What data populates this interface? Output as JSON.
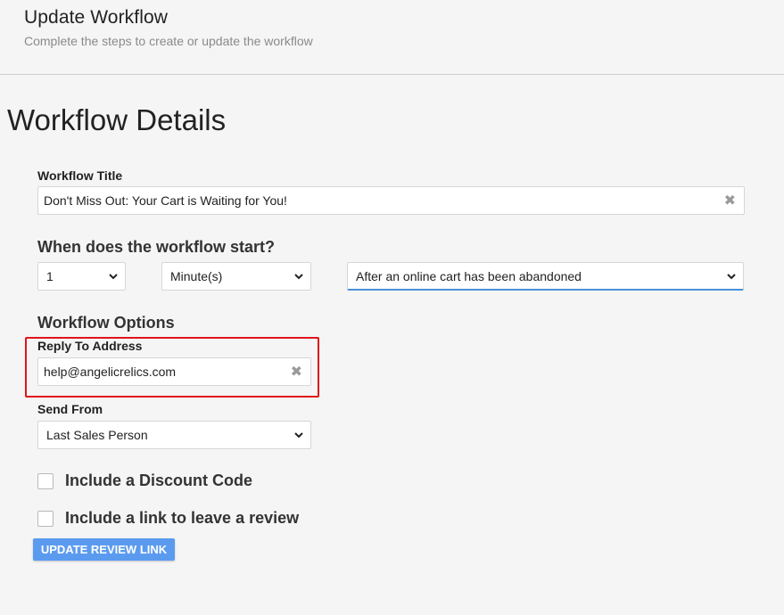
{
  "header": {
    "title": "Update Workflow",
    "subtitle": "Complete the steps to create or update the workflow"
  },
  "section": {
    "title": "Workflow Details"
  },
  "workflow_title": {
    "label": "Workflow Title",
    "value": "Don't Miss Out: Your Cart is Waiting for You!",
    "clear_icon": "✖"
  },
  "start": {
    "heading": "When does the workflow start?",
    "amount": "1",
    "unit": "Minute(s)",
    "trigger": "After an online cart has been abandoned"
  },
  "options": {
    "heading": "Workflow Options",
    "reply_to_label": "Reply To Address",
    "reply_to_value": "help@angelicrelics.com",
    "clear_icon": "✖",
    "send_from_label": "Send From",
    "send_from_value": "Last Sales Person",
    "discount_label": "Include a Discount Code",
    "review_label": "Include a link to leave a review"
  },
  "button": {
    "update_review_link": "UPDATE REVIEW LINK"
  },
  "colors": {
    "highlight": "#e0141b",
    "button": "#5b9bef",
    "focus": "#4a90d9"
  }
}
